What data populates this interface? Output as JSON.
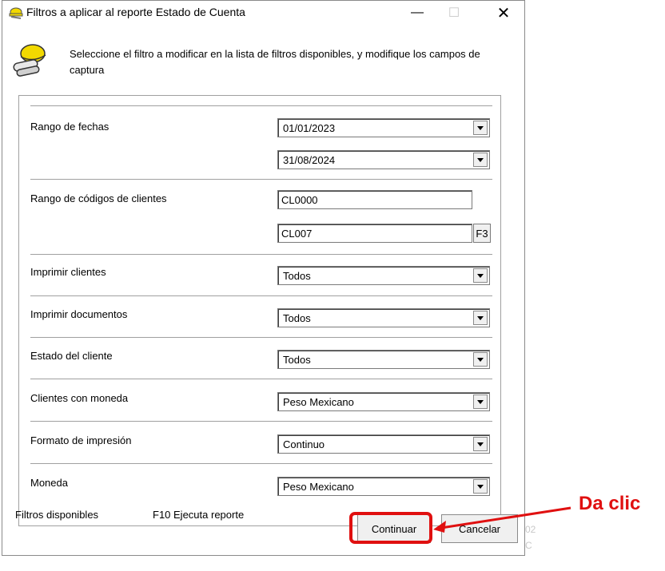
{
  "window": {
    "title": "Filtros a aplicar al reporte Estado de Cuenta",
    "controls": {
      "minimize": "—",
      "maximize": "☐",
      "close": "✕"
    }
  },
  "header": {
    "instructions": "Seleccione el filtro a modificar  en la lista de filtros disponibles, y modifique los campos de  captura"
  },
  "filters": {
    "date_range": {
      "label": "Rango de fechas",
      "from": "01/01/2023",
      "to": "31/08/2024"
    },
    "client_code_range": {
      "label": "Rango de códigos de clientes",
      "from": "CL0000",
      "to": "CL007",
      "lookup_button": "F3"
    },
    "print_clients": {
      "label": "Imprimir clientes",
      "value": "Todos"
    },
    "print_documents": {
      "label": "Imprimir documentos",
      "value": "Todos"
    },
    "client_status": {
      "label": "Estado del cliente",
      "value": "Todos"
    },
    "client_currency": {
      "label": "Clientes con moneda",
      "value": "Peso Mexicano"
    },
    "print_format": {
      "label": "Formato de impresión",
      "value": "Continuo"
    },
    "currency": {
      "label": "Moneda",
      "value": "Peso Mexicano"
    }
  },
  "footer": {
    "available_filters": "Filtros disponibles",
    "run_hint": "F10 Ejecuta reporte",
    "continue_button": "Continuar",
    "cancel_button": "Cancelar"
  },
  "annotation": {
    "text": "Da clic",
    "color": "#e01010"
  },
  "background_fragment": {
    "line1": "02",
    "line2": "C"
  }
}
